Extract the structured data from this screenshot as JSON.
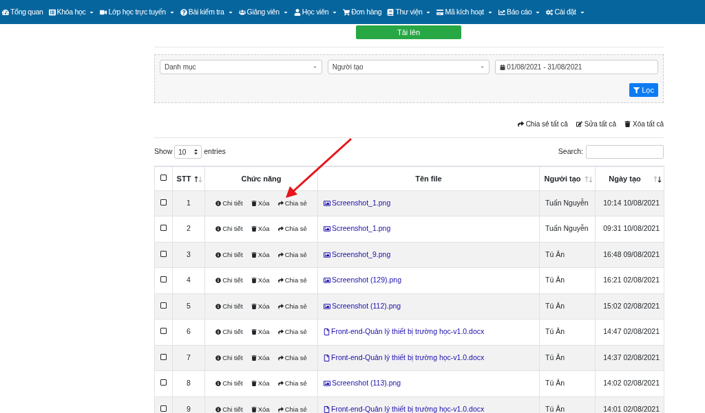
{
  "navbar": {
    "items": [
      {
        "label": "Tổng quan",
        "has_menu": false
      },
      {
        "label": "Khóa học",
        "has_menu": true
      },
      {
        "label": "Lớp học trực tuyến",
        "has_menu": true
      },
      {
        "label": "Bài kiểm tra",
        "has_menu": true
      },
      {
        "label": "Giảng viên",
        "has_menu": true
      },
      {
        "label": "Học viên",
        "has_menu": true
      },
      {
        "label": "Đơn hàng",
        "has_menu": false
      },
      {
        "label": "Thư viện",
        "has_menu": true
      },
      {
        "label": "Mã kích hoạt",
        "has_menu": true
      },
      {
        "label": "Báo cáo",
        "has_menu": true
      },
      {
        "label": "Cài đặt",
        "has_menu": true
      }
    ]
  },
  "upload_button": "Tải lên",
  "filters": {
    "category": {
      "placeholder": "Danh mục"
    },
    "creator": {
      "placeholder": "Người tạo"
    },
    "date_range": "01/08/2021 - 31/08/2021",
    "filter_button": "Lọc"
  },
  "bulk_actions": [
    "Chia sẻ tất cả",
    "Sửa tất cả",
    "Xóa tất cả"
  ],
  "length_menu": {
    "show": "Show",
    "value": "10",
    "entries": "entries"
  },
  "search": {
    "label": "Search:"
  },
  "table": {
    "select_all_checked": false,
    "columns": [
      {
        "label": "STT",
        "sortable": true,
        "up_active": true,
        "down_active": false
      },
      {
        "label": "Chức năng",
        "sortable": false
      },
      {
        "label": "Tên file",
        "sortable": false
      },
      {
        "label": "Người tạo",
        "sortable": true,
        "up_active": false,
        "down_active": false
      },
      {
        "label": "Ngày tạo",
        "sortable": true,
        "up_active": false,
        "down_active": true
      }
    ],
    "rows": [
      {
        "checked": false,
        "stt": "1",
        "actions": [
          "Chi tiết",
          "Xóa",
          "Chia sẻ"
        ],
        "file": "Screenshot_1.png",
        "kind": "image",
        "creator": "Tuấn Nguyễn",
        "date": "10:14 10/08/2021"
      },
      {
        "checked": false,
        "stt": "2",
        "actions": [
          "Chi tiết",
          "Xóa",
          "Chia sẻ"
        ],
        "file": "Screenshot_1.png",
        "kind": "image",
        "creator": "Tuấn Nguyễn",
        "date": "09:31 10/08/2021"
      },
      {
        "checked": false,
        "stt": "3",
        "actions": [
          "Chi tiết",
          "Xóa",
          "Chia sẻ"
        ],
        "file": "Screenshot_9.png",
        "kind": "image",
        "creator": "Tú Ân",
        "date": "16:48 09/08/2021"
      },
      {
        "checked": false,
        "stt": "4",
        "actions": [
          "Chi tiết",
          "Xóa",
          "Chia sẻ"
        ],
        "file": "Screenshot (129).png",
        "kind": "image",
        "creator": "Tú Ân",
        "date": "16:21 02/08/2021"
      },
      {
        "checked": false,
        "stt": "5",
        "actions": [
          "Chi tiết",
          "Xóa",
          "Chia sẻ"
        ],
        "file": "Screenshot (112).png",
        "kind": "image",
        "creator": "Tú Ân",
        "date": "15:02 02/08/2021"
      },
      {
        "checked": false,
        "stt": "6",
        "actions": [
          "Chi tiết",
          "Xóa",
          "Chia sẻ"
        ],
        "file": "Front-end-Quản lý thiết bị trường học-v1.0.docx",
        "kind": "document",
        "creator": "Tú Ân",
        "date": "14:47 02/08/2021"
      },
      {
        "checked": false,
        "stt": "7",
        "actions": [
          "Chi tiết",
          "Xóa",
          "Chia sẻ"
        ],
        "file": "Front-end-Quản lý thiết bị trường học-v1.0.docx",
        "kind": "document",
        "creator": "Tú Ân",
        "date": "14:37 02/08/2021"
      },
      {
        "checked": false,
        "stt": "8",
        "actions": [
          "Chi tiết",
          "Xóa",
          "Chia sẻ"
        ],
        "file": "Screenshot (113).png",
        "kind": "image",
        "creator": "Tú Ân",
        "date": "14:02 02/08/2021"
      },
      {
        "checked": false,
        "stt": "9",
        "actions": [
          "Chi tiết",
          "Xóa",
          "Chia sẻ"
        ],
        "file": "Front-end-Quản lý thiết bị trường học-v1.0.docx",
        "kind": "document",
        "creator": "Tú Ân",
        "date": "14:01 02/08/2021"
      }
    ]
  }
}
